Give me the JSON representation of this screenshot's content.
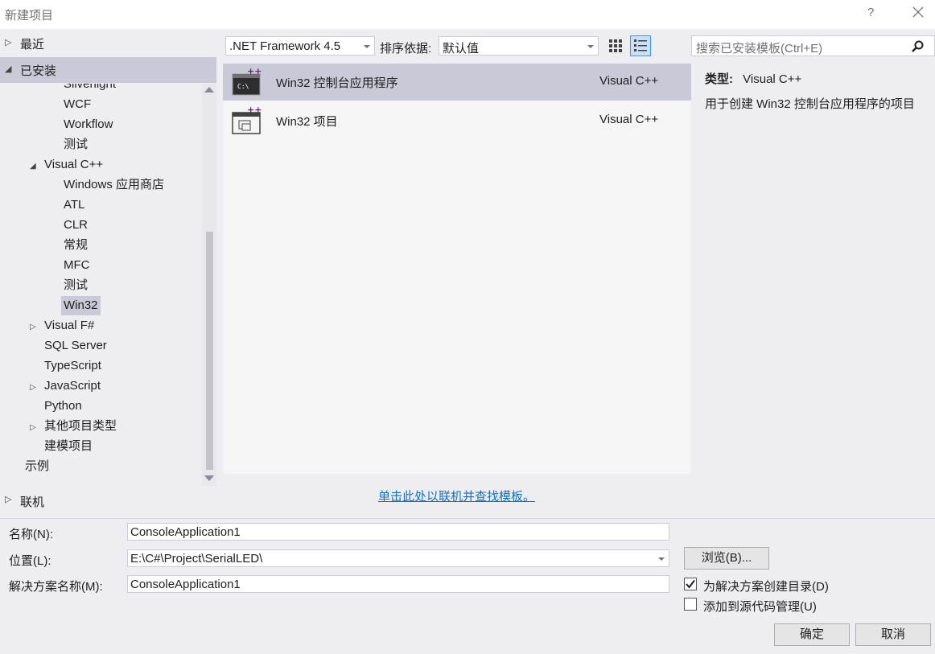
{
  "window": {
    "title": "新建项目",
    "help": "?"
  },
  "tree": {
    "recent": "最近",
    "installed": "已安装",
    "online": "联机",
    "items": [
      {
        "label": "Silverlight",
        "level": 2,
        "expander": ""
      },
      {
        "label": "WCF",
        "level": 2,
        "expander": ""
      },
      {
        "label": "Workflow",
        "level": 2,
        "expander": ""
      },
      {
        "label": "测试",
        "level": 2,
        "expander": ""
      },
      {
        "label": "Visual C++",
        "level": 1,
        "expander": "◢"
      },
      {
        "label": "Windows 应用商店",
        "level": 2,
        "expander": ""
      },
      {
        "label": "ATL",
        "level": 2,
        "expander": ""
      },
      {
        "label": "CLR",
        "level": 2,
        "expander": ""
      },
      {
        "label": "常规",
        "level": 2,
        "expander": ""
      },
      {
        "label": "MFC",
        "level": 2,
        "expander": ""
      },
      {
        "label": "测试",
        "level": 2,
        "expander": ""
      },
      {
        "label": "Win32",
        "level": 2,
        "expander": ""
      },
      {
        "label": "Visual F#",
        "level": 1,
        "expander": "▷"
      },
      {
        "label": "SQL Server",
        "level": 1,
        "expander": ""
      },
      {
        "label": "TypeScript",
        "level": 1,
        "expander": ""
      },
      {
        "label": "JavaScript",
        "level": 1,
        "expander": "▷"
      },
      {
        "label": "Python",
        "level": 1,
        "expander": ""
      },
      {
        "label": "其他项目类型",
        "level": 1,
        "expander": "▷"
      },
      {
        "label": "建模项目",
        "level": 1,
        "expander": ""
      },
      {
        "label": "示例",
        "level": 0,
        "expander": ""
      }
    ]
  },
  "toolbar": {
    "framework": ".NET Framework 4.5",
    "sort_label": "排序依据:",
    "sort_value": "默认值",
    "search_placeholder": "搜索已安装模板(Ctrl+E)"
  },
  "templates": [
    {
      "name": "Win32 控制台应用程序",
      "lang": "Visual C++",
      "selected": true
    },
    {
      "name": "Win32 项目",
      "lang": "Visual C++",
      "selected": false
    }
  ],
  "online_link": "单击此处以联机并查找模板。",
  "details": {
    "type_label": "类型:",
    "type_value": "Visual C++",
    "description": "用于创建 Win32 控制台应用程序的项目"
  },
  "form": {
    "name_label": "名称(N):",
    "name_value": "ConsoleApplication1",
    "location_label": "位置(L):",
    "location_value": "E:\\C#\\Project\\SerialLED\\",
    "solution_label": "解决方案名称(M):",
    "solution_value": "ConsoleApplication1",
    "browse": "浏览(B)...",
    "create_dir_label": "为解决方案创建目录(D)",
    "create_dir_checked": true,
    "source_control_label": "添加到源代码管理(U)",
    "source_control_checked": false,
    "ok": "确定",
    "cancel": "取消"
  }
}
